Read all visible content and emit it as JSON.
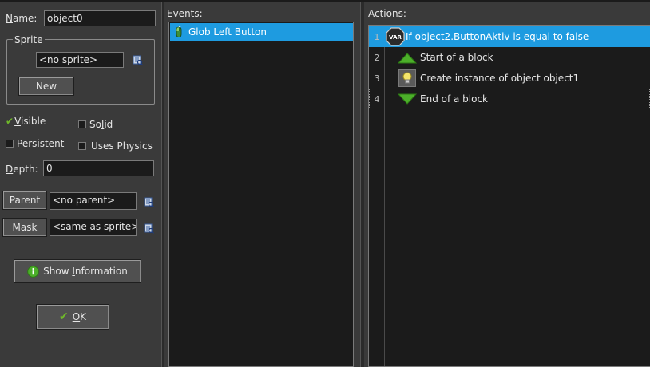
{
  "object_form": {
    "name_label": "Name:",
    "name_value": "object0",
    "sprite_group_title": "Sprite",
    "sprite_value": "<no sprite>",
    "new_button": "New",
    "visible_label": "Visible",
    "visible_checked": true,
    "solid_label": "Solid",
    "solid_checked": false,
    "persistent_label": "Persistent",
    "persistent_checked": false,
    "uses_physics_label": "Uses Physics",
    "uses_physics_checked": false,
    "depth_label": "Depth:",
    "depth_value": "0",
    "parent_button": "Parent",
    "parent_value": "<no parent>",
    "mask_button": "Mask",
    "mask_value": "<same as sprite>",
    "show_information_button": "Show Information",
    "ok_button": "OK"
  },
  "events": {
    "header": "Events:",
    "items": [
      {
        "label": "Glob Left Button",
        "icon": "mouse-icon",
        "selected": true
      }
    ]
  },
  "actions": {
    "header": "Actions:",
    "rows": [
      {
        "num": "1",
        "text": "If object2.ButtonAktiv is equal to false",
        "icon": "var-icon",
        "selected": true
      },
      {
        "num": "2",
        "text": "Start of a block",
        "icon": "block-start-icon",
        "selected": false
      },
      {
        "num": "3",
        "text": "Create instance of object object1",
        "icon": "create-instance-icon",
        "selected": false
      },
      {
        "num": "4",
        "text": "End of a block",
        "icon": "block-end-icon",
        "selected": false
      }
    ]
  },
  "colors": {
    "selection": "#1e9be0",
    "panel": "#3a3a3a",
    "list_bg": "#1b1b1b",
    "accent_green": "#6fb82a"
  }
}
